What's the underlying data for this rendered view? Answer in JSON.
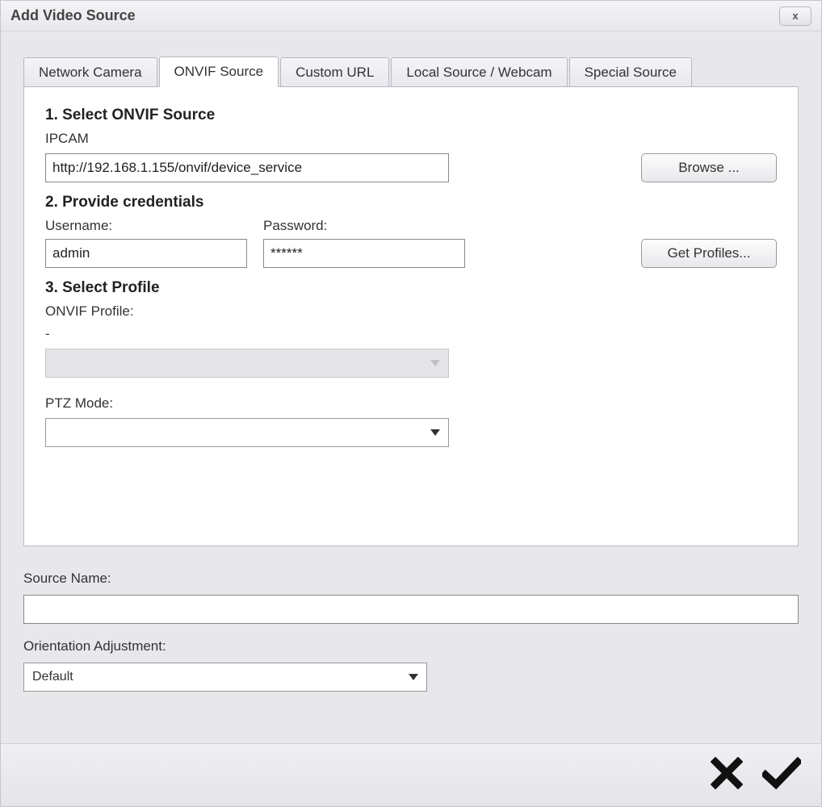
{
  "window": {
    "title": "Add Video Source",
    "close_label": "x"
  },
  "tabs": [
    {
      "label": "Network Camera",
      "active": false
    },
    {
      "label": "ONVIF Source",
      "active": true
    },
    {
      "label": "Custom URL",
      "active": false
    },
    {
      "label": "Local Source / Webcam",
      "active": false
    },
    {
      "label": "Special Source",
      "active": false
    }
  ],
  "section1": {
    "title": "1. Select ONVIF Source",
    "source_label": "IPCAM",
    "url": "http://192.168.1.155/onvif/device_service",
    "browse_label": "Browse ..."
  },
  "section2": {
    "title": "2. Provide credentials",
    "username_label": "Username:",
    "password_label": "Password:",
    "username_value": "admin",
    "password_value": "******",
    "get_profiles_label": "Get Profiles..."
  },
  "section3": {
    "title": "3. Select Profile",
    "onvif_profile_label": "ONVIF Profile:",
    "profile_value": "-",
    "ptz_label": "PTZ Mode:",
    "ptz_value": ""
  },
  "lower": {
    "source_name_label": "Source Name:",
    "source_name_value": "",
    "orientation_label": "Orientation Adjustment:",
    "orientation_value": "Default"
  },
  "footer": {
    "cancel": "Cancel",
    "ok": "OK"
  }
}
